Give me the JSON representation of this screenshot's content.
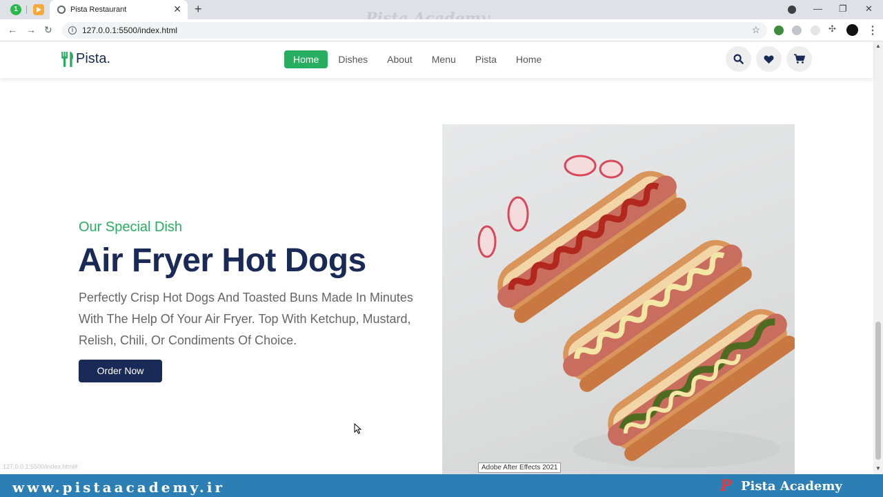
{
  "browser": {
    "pinned_tab_1_badge": "1",
    "active_tab_title": "Pista Restaurant",
    "url": "127.0.0.1:5500/index.html",
    "watermark": "Pista Academy",
    "status_url": "127.0.0.1:5500/index.html#",
    "tooltip": "Adobe After Effects 2021"
  },
  "site": {
    "logo_text": "Pista.",
    "nav": [
      "Home",
      "Dishes",
      "About",
      "Menu",
      "Pista",
      "Home"
    ],
    "active_nav": "Home",
    "icons": [
      "search-icon",
      "heart-icon",
      "cart-icon"
    ]
  },
  "hero": {
    "subtitle": "Our Special Dish",
    "title": "Air Fryer Hot Dogs",
    "description": "Perfectly Crisp Hot Dogs And Toasted Buns Made In Minutes With The Help Of Your Air Fryer. Top With Ketchup, Mustard, Relish, Chili, Or Condiments Of Choice.",
    "button": "Order Now",
    "image_subject": "three hot dogs with ketchup, mustard and fried onions"
  },
  "branding": {
    "url": "www.pistaacademy.ir",
    "logo_letter": "P",
    "name": "Pista Academy"
  },
  "colors": {
    "green": "#27ae60",
    "navy": "#192a56",
    "brand_bar": "#2b7fb5"
  }
}
